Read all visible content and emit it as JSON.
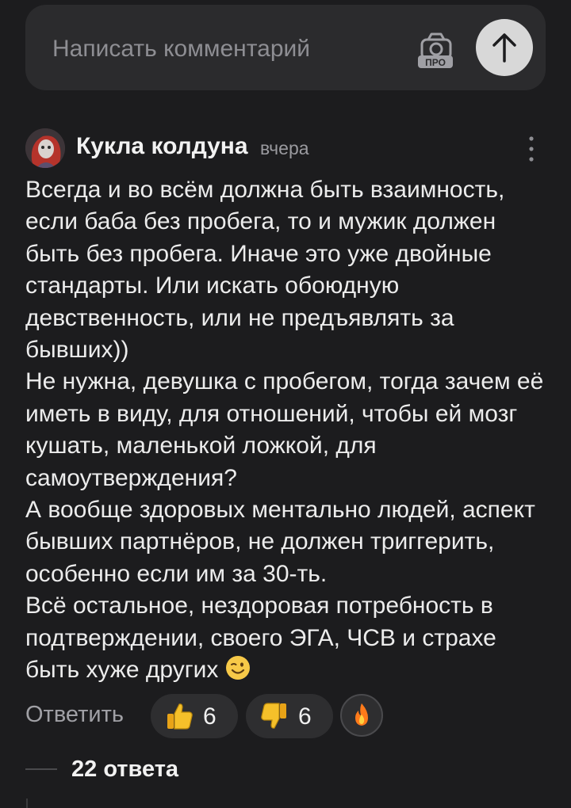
{
  "composer": {
    "placeholder": "Написать комментарий",
    "pro_badge": "ПРО",
    "camera_icon": "camera-icon",
    "send_icon": "arrow-up-icon"
  },
  "comment": {
    "author": "Кукла колдуна",
    "time": "вчера",
    "paragraphs": [
      "Всегда и во всём должна быть взаимность, если баба без пробега, то и мужик должен быть без пробега. Иначе это уже двойные стандарты. Или искать обоюдную девственность, или не предъявлять за бывших))",
      "Не нужна, девушка с пробегом, тогда зачем её иметь в виду, для отношений, чтобы ей мозг кушать, маленькой ложкой, для самоутверждения?",
      "А вообще здоровых ментально людей, аспект бывших партнёров, не должен триггерить, особенно если им за 30-ть.",
      "Всё остальное, нездоровая потребность в подтверждении, своего ЭГА, ЧСВ и страхе быть хуже других"
    ],
    "trailing_emoji": "winking-face-emoji"
  },
  "actions": {
    "reply": "Ответить",
    "likes": "6",
    "dislikes": "6",
    "like_icon": "thumbs-up-icon",
    "dislike_icon": "thumbs-down-icon",
    "fire_icon": "fire-icon"
  },
  "replies": {
    "count_label": "22 ответа"
  },
  "colors": {
    "background": "#1c1c1e",
    "surface": "#2b2b2d",
    "send_button": "#d8d8d8",
    "thumb_yellow": "#f5c02a",
    "fire_orange": "#ff7a1a"
  }
}
